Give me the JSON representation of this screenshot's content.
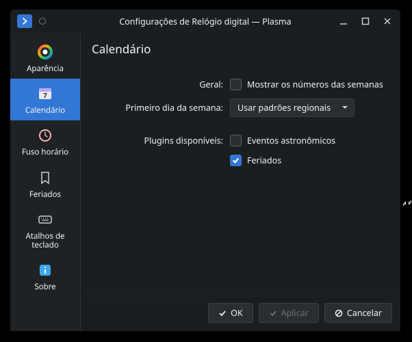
{
  "window": {
    "title": "Configurações de Relógio digital — Plasma"
  },
  "sidebar": {
    "items": [
      {
        "label": "Aparência"
      },
      {
        "label": "Calendário"
      },
      {
        "label": "Fuso horário"
      },
      {
        "label": "Feriados"
      },
      {
        "label": "Atalhos de teclado"
      },
      {
        "label": "Sobre"
      }
    ],
    "selected_index": 1
  },
  "page": {
    "title": "Calendário",
    "rows": {
      "general_label": "Geral:",
      "show_weeknums_label": "Mostrar os números das semanas",
      "first_dow_label": "Primeiro dia da semana:",
      "first_dow_value": "Usar padrões regionais",
      "plugins_label": "Plugins disponíveis:",
      "plugin_astro_label": "Eventos astronômicos",
      "plugin_holidays_label": "Feriados"
    },
    "state": {
      "show_weeknums": false,
      "plugin_astro": false,
      "plugin_holidays": true
    }
  },
  "buttons": {
    "ok": "OK",
    "apply": "Aplicar",
    "cancel": "Cancelar",
    "apply_enabled": false
  },
  "colors": {
    "accent": "#3377d4",
    "bg": "#1b1e20",
    "panel": "#1f2225",
    "control": "#2a2e32"
  }
}
